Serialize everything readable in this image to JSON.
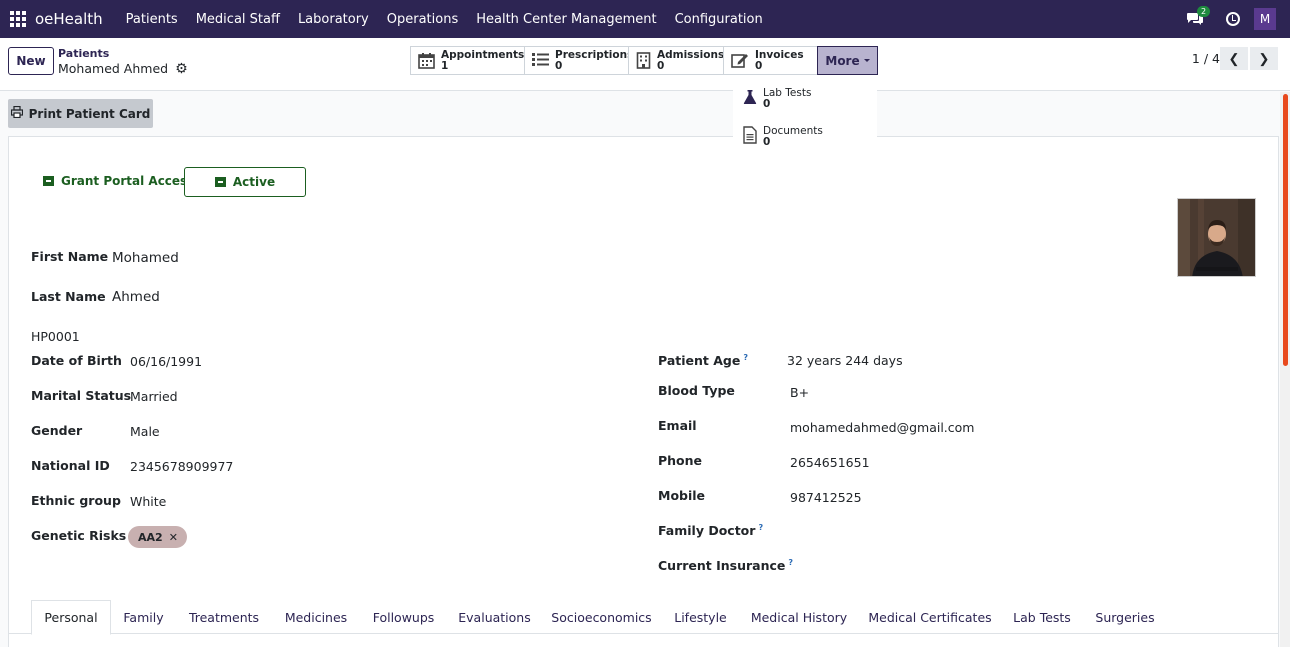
{
  "topbar": {
    "brand": "oeHealth",
    "menu": [
      "Patients",
      "Medical Staff",
      "Laboratory",
      "Operations",
      "Health Center Management",
      "Configuration"
    ],
    "chat_count": "2",
    "user_initial": "M"
  },
  "control": {
    "new_label": "New",
    "breadcrumb": "Patients",
    "record_name": "Mohamed Ahmed",
    "pager": "1 / 4"
  },
  "stat_buttons": [
    {
      "label": "Appointments",
      "count": "1",
      "icon": "calendar-icon"
    },
    {
      "label": "Prescriptions",
      "count": "0",
      "icon": "list-icon"
    },
    {
      "label": "Admissions",
      "count": "0",
      "icon": "building-icon"
    },
    {
      "label": "Invoices",
      "count": "0",
      "icon": "edit-icon"
    }
  ],
  "more_label": "More",
  "more_menu": [
    {
      "label": "Lab Tests",
      "count": "0",
      "icon": "flask-icon"
    },
    {
      "label": "Documents",
      "count": "0",
      "icon": "document-icon"
    }
  ],
  "print_label": "Print Patient Card",
  "header_buttons": {
    "portal": "Grant Portal Access",
    "active": "Active"
  },
  "patient": {
    "first_name_label": "First Name",
    "first_name": "Mohamed",
    "last_name_label": "Last Name",
    "last_name": "Ahmed",
    "ref": "HP0001"
  },
  "left_fields": [
    {
      "label": "Date of Birth",
      "value": "06/16/1991"
    },
    {
      "label": "Marital Status",
      "value": "Married"
    },
    {
      "label": "Gender",
      "value": "Male"
    },
    {
      "label": "National ID",
      "value": "2345678909977"
    },
    {
      "label": "Ethnic group",
      "value": "White"
    },
    {
      "label": "Genetic Risks",
      "value": ""
    }
  ],
  "genetic_tag": "AA2",
  "right_fields": [
    {
      "label": "Patient Age",
      "value": "32 years 244 days",
      "help": "?"
    },
    {
      "label": "Blood Type",
      "value": "B+"
    },
    {
      "label": "Email",
      "value": "mohamedahmed@gmail.com"
    },
    {
      "label": "Phone",
      "value": "2654651651"
    },
    {
      "label": "Mobile",
      "value": "987412525"
    },
    {
      "label": "Family Doctor",
      "value": "",
      "help": "?"
    },
    {
      "label": "Current Insurance",
      "value": "",
      "help": "?"
    }
  ],
  "tabs": [
    "Personal",
    "Family",
    "Treatments",
    "Medicines",
    "Followups",
    "Evaluations",
    "Socioeconomics",
    "Lifestyle",
    "Medical History",
    "Medical Certificates",
    "Lab Tests",
    "Surgeries"
  ],
  "active_tab": "Personal"
}
